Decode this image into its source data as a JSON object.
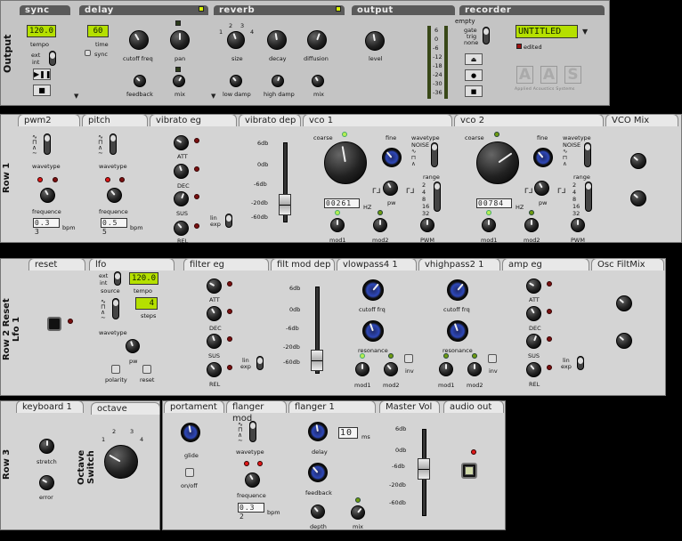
{
  "output_bar": {
    "section_label": "Output",
    "sync": {
      "title": "sync",
      "tempo_value": "120.0",
      "tempo_label": "tempo",
      "ext_label": "ext",
      "int_label": "int"
    },
    "delay": {
      "title": "delay",
      "time_value": "60",
      "time_label": "time",
      "sync_label": "sync",
      "cutoff_label": "cutoff freq",
      "pan_label": "pan",
      "feedback_label": "feedback",
      "mix_label": "mix"
    },
    "reverb": {
      "title": "reverb",
      "size_ticks": [
        "1",
        "2",
        "3",
        "4"
      ],
      "size_label": "size",
      "decay_label": "decay",
      "diffusion_label": "diffusion",
      "lowdamp_label": "low damp",
      "highdamp_label": "high damp",
      "mix_label": "mix"
    },
    "output": {
      "title": "output",
      "meter_ticks": [
        "6",
        "0",
        "-6",
        "-12",
        "-18",
        "-24",
        "-30",
        "-36"
      ],
      "level_label": "level"
    },
    "recorder": {
      "title": "recorder",
      "status": "empty",
      "gate_label": "gate",
      "trig_label": "trig",
      "none_label": "none",
      "song_name": "UNTITLED",
      "edited_label": "edited"
    },
    "logo": {
      "letters": [
        "A",
        "A",
        "S"
      ],
      "tagline": "Applied Acoustics Systems"
    }
  },
  "row1": {
    "label": "Row 1",
    "pwm2": {
      "title": "pwm2",
      "wave_label": "wavetype",
      "freq_label": "frequence",
      "freq_value": "0.3 3",
      "bpm_label": "bpm"
    },
    "pitch": {
      "title": "pitch",
      "wave_label": "wavetype",
      "freq_label": "frequence",
      "freq_value": "0.5 5",
      "bpm_label": "bpm"
    },
    "vibrato_eg": {
      "title": "vibrato eg",
      "att": "ATT",
      "dec": "DEC",
      "sus": "SUS",
      "rel": "REL",
      "lin": "lin",
      "exp": "exp"
    },
    "vibrato_dep": {
      "title": "vibrato dep",
      "ticks": [
        "6db",
        "0db",
        "-6db",
        "-20db",
        "-60db"
      ]
    },
    "vco1": {
      "title": "vco 1",
      "coarse": "coarse",
      "fine": "fine",
      "wavetype": "wavetype",
      "freq": "00261",
      "hz": "HZ",
      "pw": "pw",
      "range": "range",
      "ranges": [
        "2",
        "4",
        "8",
        "16",
        "32"
      ],
      "mod1": "mod1",
      "mod2": "mod2",
      "pwm": "PWM"
    },
    "vco2": {
      "title": "vco 2",
      "coarse": "coarse",
      "fine": "fine",
      "wavetype": "wavetype",
      "freq": "00784",
      "hz": "HZ",
      "pw": "pw",
      "range": "range",
      "ranges": [
        "2",
        "4",
        "8",
        "16",
        "32"
      ],
      "mod1": "mod1",
      "mod2": "mod2",
      "pwm": "PWM"
    },
    "vco_mix": {
      "title": "VCO Mix"
    }
  },
  "row2": {
    "label": "Row 2  Reset Lfo 1",
    "reset": {
      "title": "reset"
    },
    "lfo": {
      "title": "lfo",
      "ext": "ext",
      "int": "int",
      "source": "source",
      "tempo_value": "120.0",
      "tempo": "tempo",
      "steps_value": "4",
      "steps": "steps",
      "wavetype": "wavetype",
      "pw": "pw",
      "polarity": "polarity",
      "reset": "reset"
    },
    "filter_eg": {
      "title": "filter eg",
      "att": "ATT",
      "dec": "DEC",
      "sus": "SUS",
      "rel": "REL",
      "lin": "lin",
      "exp": "exp"
    },
    "filt_mod_dep": {
      "title": "filt mod dep",
      "ticks": [
        "6db",
        "0db",
        "-6db",
        "-20db",
        "-60db"
      ]
    },
    "vlowpass": {
      "title": "vlowpass4 1",
      "cutoff": "cutoff frq",
      "resonance": "resonance",
      "mod1": "mod1",
      "mod2": "mod2",
      "inv": "inv"
    },
    "vhighpass": {
      "title": "vhighpass2 1",
      "cutoff": "cutoff frq",
      "resonance": "resonance",
      "mod1": "mod1",
      "mod2": "mod2",
      "inv": "inv"
    },
    "amp_eg": {
      "title": "amp eg",
      "att": "ATT",
      "dec": "DEC",
      "sus": "SUS",
      "rel": "REL",
      "lin": "lin",
      "exp": "exp"
    },
    "osc_filtmix": {
      "title": "Osc FiltMix"
    }
  },
  "row3": {
    "label": "Row 3",
    "keyboard": {
      "title": "keyboard 1",
      "stretch": "stretch",
      "error": "error"
    },
    "octave": {
      "title": "octave",
      "side_label": "Octave Switch",
      "ticks": [
        "1",
        "2",
        "3",
        "4"
      ]
    },
    "portament": {
      "title": "portament",
      "glide": "glide",
      "onoff": "on/off"
    },
    "flanger_mod": {
      "title": "flanger mod",
      "wavetype": "wavetype",
      "freq": "frequence",
      "freq_value": "0.3 2",
      "bpm": "bpm"
    },
    "flanger": {
      "title": "flanger 1",
      "delay": "delay",
      "delay_value": "10",
      "ms": "ms",
      "feedback": "feedback",
      "depth": "depth",
      "mix": "mix"
    },
    "master_vol": {
      "title": "Master Vol",
      "ticks": [
        "6db",
        "0db",
        "-6db",
        "-20db",
        "-60db"
      ]
    },
    "audio_out": {
      "title": "audio out"
    }
  }
}
